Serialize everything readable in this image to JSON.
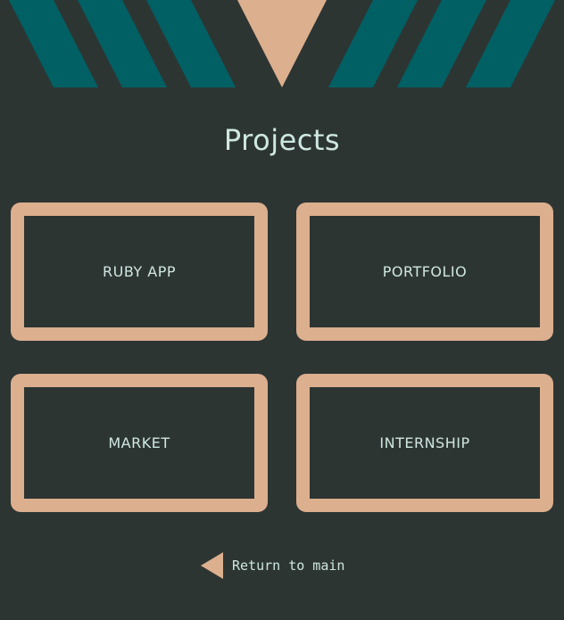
{
  "page": {
    "title": "Projects"
  },
  "projects": [
    {
      "label": "RUBY APP"
    },
    {
      "label": "PORTFOLIO"
    },
    {
      "label": "MARKET"
    },
    {
      "label": "INTERNSHIP"
    }
  ],
  "navigation": {
    "return_label": "Return to main",
    "return_icon": "triangle-left-icon"
  },
  "colors": {
    "background": "#2d3533",
    "accent": "#dcaf8e",
    "stripes": "#006064",
    "text": "#cfe7e1"
  }
}
